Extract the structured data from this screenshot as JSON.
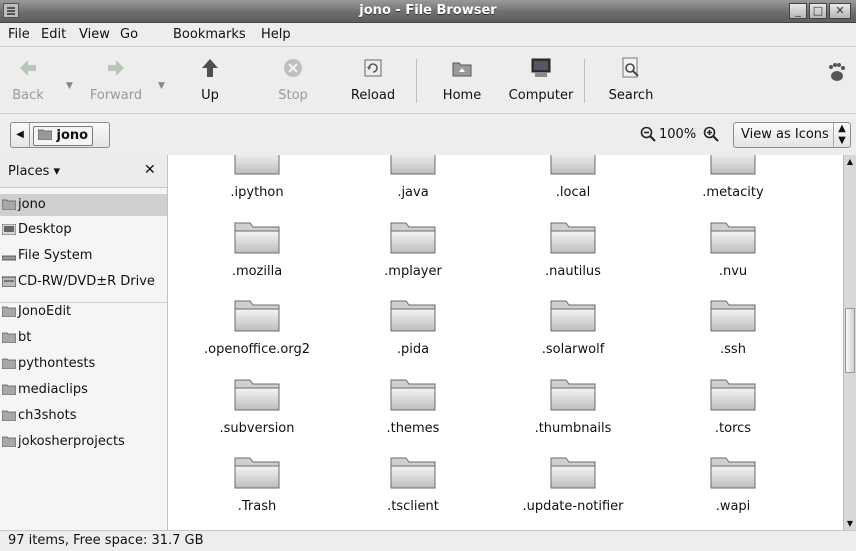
{
  "window": {
    "title": "jono - File Browser"
  },
  "menubar": [
    "File",
    "Edit",
    "View",
    "Go",
    "Bookmarks",
    "Help"
  ],
  "toolbar": {
    "back": "Back",
    "forward": "Forward",
    "up": "Up",
    "stop": "Stop",
    "reload": "Reload",
    "home": "Home",
    "computer": "Computer",
    "search": "Search"
  },
  "location": {
    "crumb": "jono",
    "zoom_level": "100%",
    "view_mode": "View as Icons"
  },
  "sidebar": {
    "header": "Places",
    "items": [
      {
        "label": "jono",
        "icon": "home-folder-icon",
        "selected": true
      },
      {
        "label": "Desktop",
        "icon": "desktop-icon"
      },
      {
        "label": "File System",
        "icon": "drive-icon"
      },
      {
        "label": "CD-RW/DVD±R Drive",
        "icon": "optical-drive-icon"
      },
      {
        "label": "JonoEdit",
        "icon": "folder-icon"
      },
      {
        "label": "bt",
        "icon": "folder-icon"
      },
      {
        "label": "pythontests",
        "icon": "folder-icon"
      },
      {
        "label": "mediaclips",
        "icon": "folder-icon"
      },
      {
        "label": "ch3shots",
        "icon": "folder-icon"
      },
      {
        "label": "jokosherprojects",
        "icon": "folder-icon"
      }
    ]
  },
  "files": [
    ".ipython",
    ".java",
    ".local",
    ".metacity",
    ".mozilla",
    ".mplayer",
    ".nautilus",
    ".nvu",
    ".openoffice.org2",
    ".pida",
    ".solarwolf",
    ".ssh",
    ".subversion",
    ".themes",
    ".thumbnails",
    ".torcs",
    ".Trash",
    ".tsclient",
    ".update-notifier",
    ".wapi"
  ],
  "status": "97 items, Free space: 31.7 GB"
}
